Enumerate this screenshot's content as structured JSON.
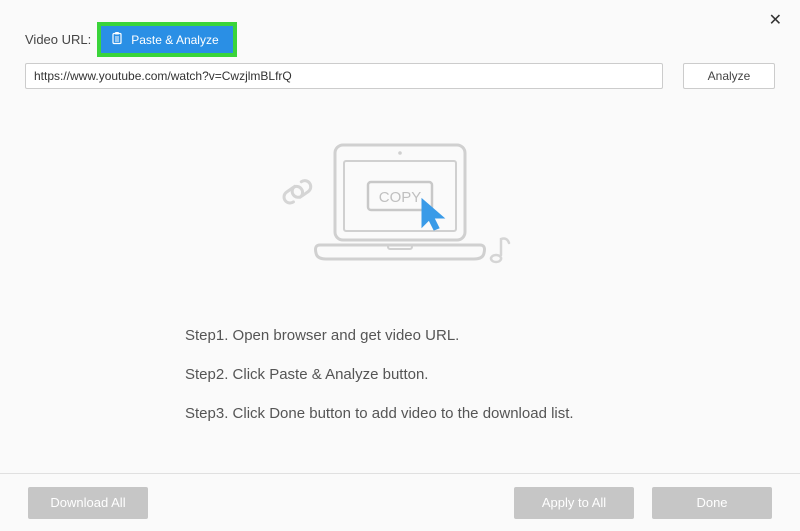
{
  "header": {
    "url_label": "Video URL:",
    "paste_analyze_label": "Paste & Analyze"
  },
  "url_input": {
    "value": "https://www.youtube.com/watch?v=CwzjlmBLfrQ",
    "placeholder": ""
  },
  "analyze_label": "Analyze",
  "illustration": {
    "copy_label": "COPY"
  },
  "steps": {
    "s1": "Step1. Open browser and get video URL.",
    "s2": "Step2. Click Paste & Analyze button.",
    "s3": "Step3. Click Done button to add video to the download list."
  },
  "footer": {
    "download_all": "Download All",
    "apply_to_all": "Apply to All",
    "done": "Done"
  }
}
